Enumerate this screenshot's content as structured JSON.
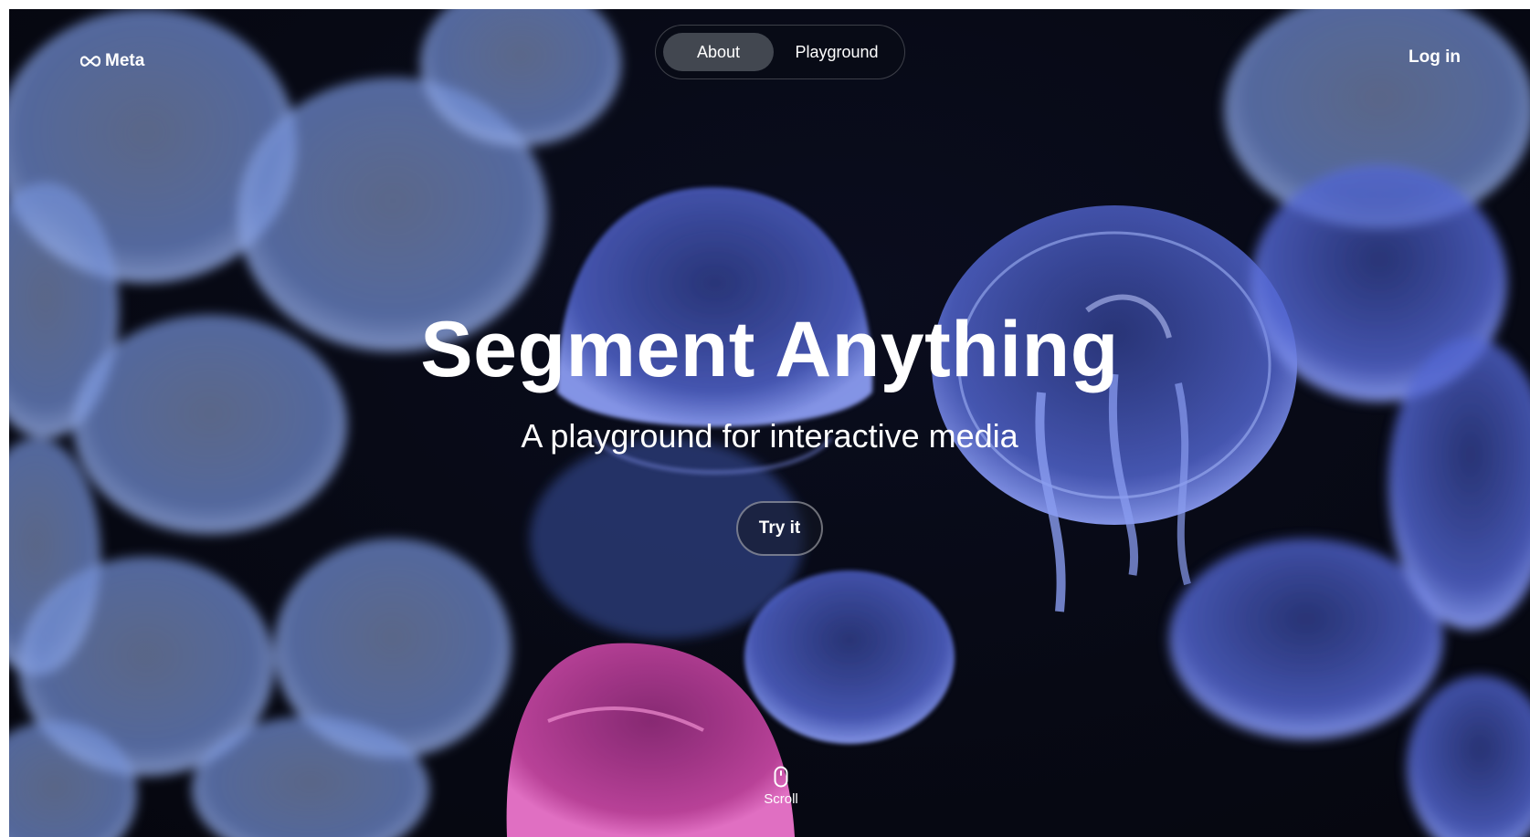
{
  "header": {
    "logo_text": "Meta",
    "logo_icon": "meta-infinity-icon",
    "tabs": [
      {
        "label": "About",
        "active": true
      },
      {
        "label": "Playground",
        "active": false
      }
    ],
    "login_label": "Log in"
  },
  "hero": {
    "title": "Segment Anything",
    "subtitle": "A playground for interactive media",
    "cta_label": "Try it",
    "scroll_label": "Scroll",
    "scroll_icon": "mouse-icon",
    "background_image": "jellyfish-background",
    "highlight_color": "#c2459f",
    "jellyfish_color": "#4b5fcf"
  }
}
